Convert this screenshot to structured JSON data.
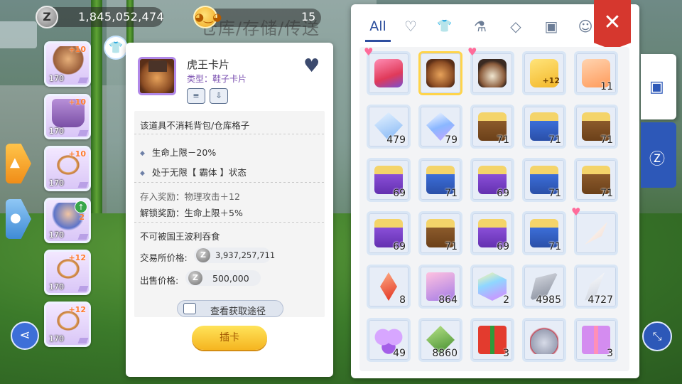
{
  "hud": {
    "zeny_icon": "Z",
    "zeny": "1,845,052,474",
    "pet_icon": "pet-face-icon",
    "pet_count": "15",
    "background_sign": "仓库/存储/传送"
  },
  "side_slots": [
    {
      "plus": "+10",
      "level": "170",
      "art": "horns"
    },
    {
      "plus": "+10",
      "level": "170",
      "art": "shirt"
    },
    {
      "plus": "+10",
      "level": "170",
      "art": "necklace"
    },
    {
      "plus": "2",
      "level": "170",
      "art": "girl"
    },
    {
      "plus": "+12",
      "level": "170",
      "art": "necklace"
    },
    {
      "plus": "+12",
      "level": "170",
      "art": "necklace"
    }
  ],
  "detail": {
    "name": "虎王卡片",
    "type": "类型：鞋子卡片",
    "note": "该道具不消耗背包/仓库格子",
    "effects": [
      "生命上限－20%",
      "处于无限【 霸体 】状态"
    ],
    "store_bonus": "存入奖励：物理攻击＋12",
    "unlock_bonus": "解锁奖励：生命上限＋5%",
    "restriction": "不可被国王波利吞食",
    "exchange_label": "交易所价格:",
    "exchange_price": "3,937,257,711",
    "sell_label": "出售价格:",
    "sell_price": "500,000",
    "coin_letter": "Z",
    "source_button": "查看获取途径",
    "insert_button": "插卡"
  },
  "inventory": {
    "tabs": [
      "All",
      "♡",
      "👕",
      "⚗",
      "◇",
      "▣",
      "☺"
    ],
    "close_label": "✕",
    "items": [
      {
        "glyph": "card-red",
        "qty": "",
        "heart": true
      },
      {
        "glyph": "card-lion",
        "qty": "",
        "selected": true
      },
      {
        "glyph": "card-mush",
        "qty": "",
        "heart": true
      },
      {
        "glyph": "gold-card",
        "qty": "",
        "plus": "+12"
      },
      {
        "glyph": "ticket",
        "qty": "11"
      },
      {
        "glyph": "crystal-a",
        "qty": "479"
      },
      {
        "glyph": "crystal-b",
        "qty": "79"
      },
      {
        "glyph": "chest-brown",
        "qty": "71"
      },
      {
        "glyph": "chest-blue",
        "qty": "71"
      },
      {
        "glyph": "chest-brown",
        "qty": "71"
      },
      {
        "glyph": "chest-purple",
        "qty": "69"
      },
      {
        "glyph": "chest-blue",
        "qty": "71"
      },
      {
        "glyph": "chest-purple",
        "qty": "69"
      },
      {
        "glyph": "chest-blue",
        "qty": "71"
      },
      {
        "glyph": "chest-brown",
        "qty": "71"
      },
      {
        "glyph": "chest-purple",
        "qty": "69"
      },
      {
        "glyph": "chest-brown",
        "qty": "71"
      },
      {
        "glyph": "chest-purple",
        "qty": "69"
      },
      {
        "glyph": "chest-blue",
        "qty": "71"
      },
      {
        "glyph": "feather",
        "qty": "",
        "heart": true
      },
      {
        "glyph": "red-shard",
        "qty": "8"
      },
      {
        "glyph": "book",
        "qty": "864"
      },
      {
        "glyph": "prism",
        "qty": "2"
      },
      {
        "glyph": "wing-grey",
        "qty": "4985"
      },
      {
        "glyph": "wing-white",
        "qty": "4727"
      },
      {
        "glyph": "butterfly",
        "qty": "49"
      },
      {
        "glyph": "leaf",
        "qty": "8860"
      },
      {
        "glyph": "gift-red",
        "qty": "3"
      },
      {
        "glyph": "potion",
        "qty": ""
      },
      {
        "glyph": "gift-purple",
        "qty": "3"
      }
    ]
  },
  "right_tabs": {
    "bag_icon": "backpack-icon",
    "zeny_bag_icon": "money-bag-icon"
  },
  "colors": {
    "accent_blue": "#2d58b8",
    "close_red": "#d6372e",
    "insert_yellow": "#f5b520",
    "card_purple": "#7a4fb0"
  }
}
